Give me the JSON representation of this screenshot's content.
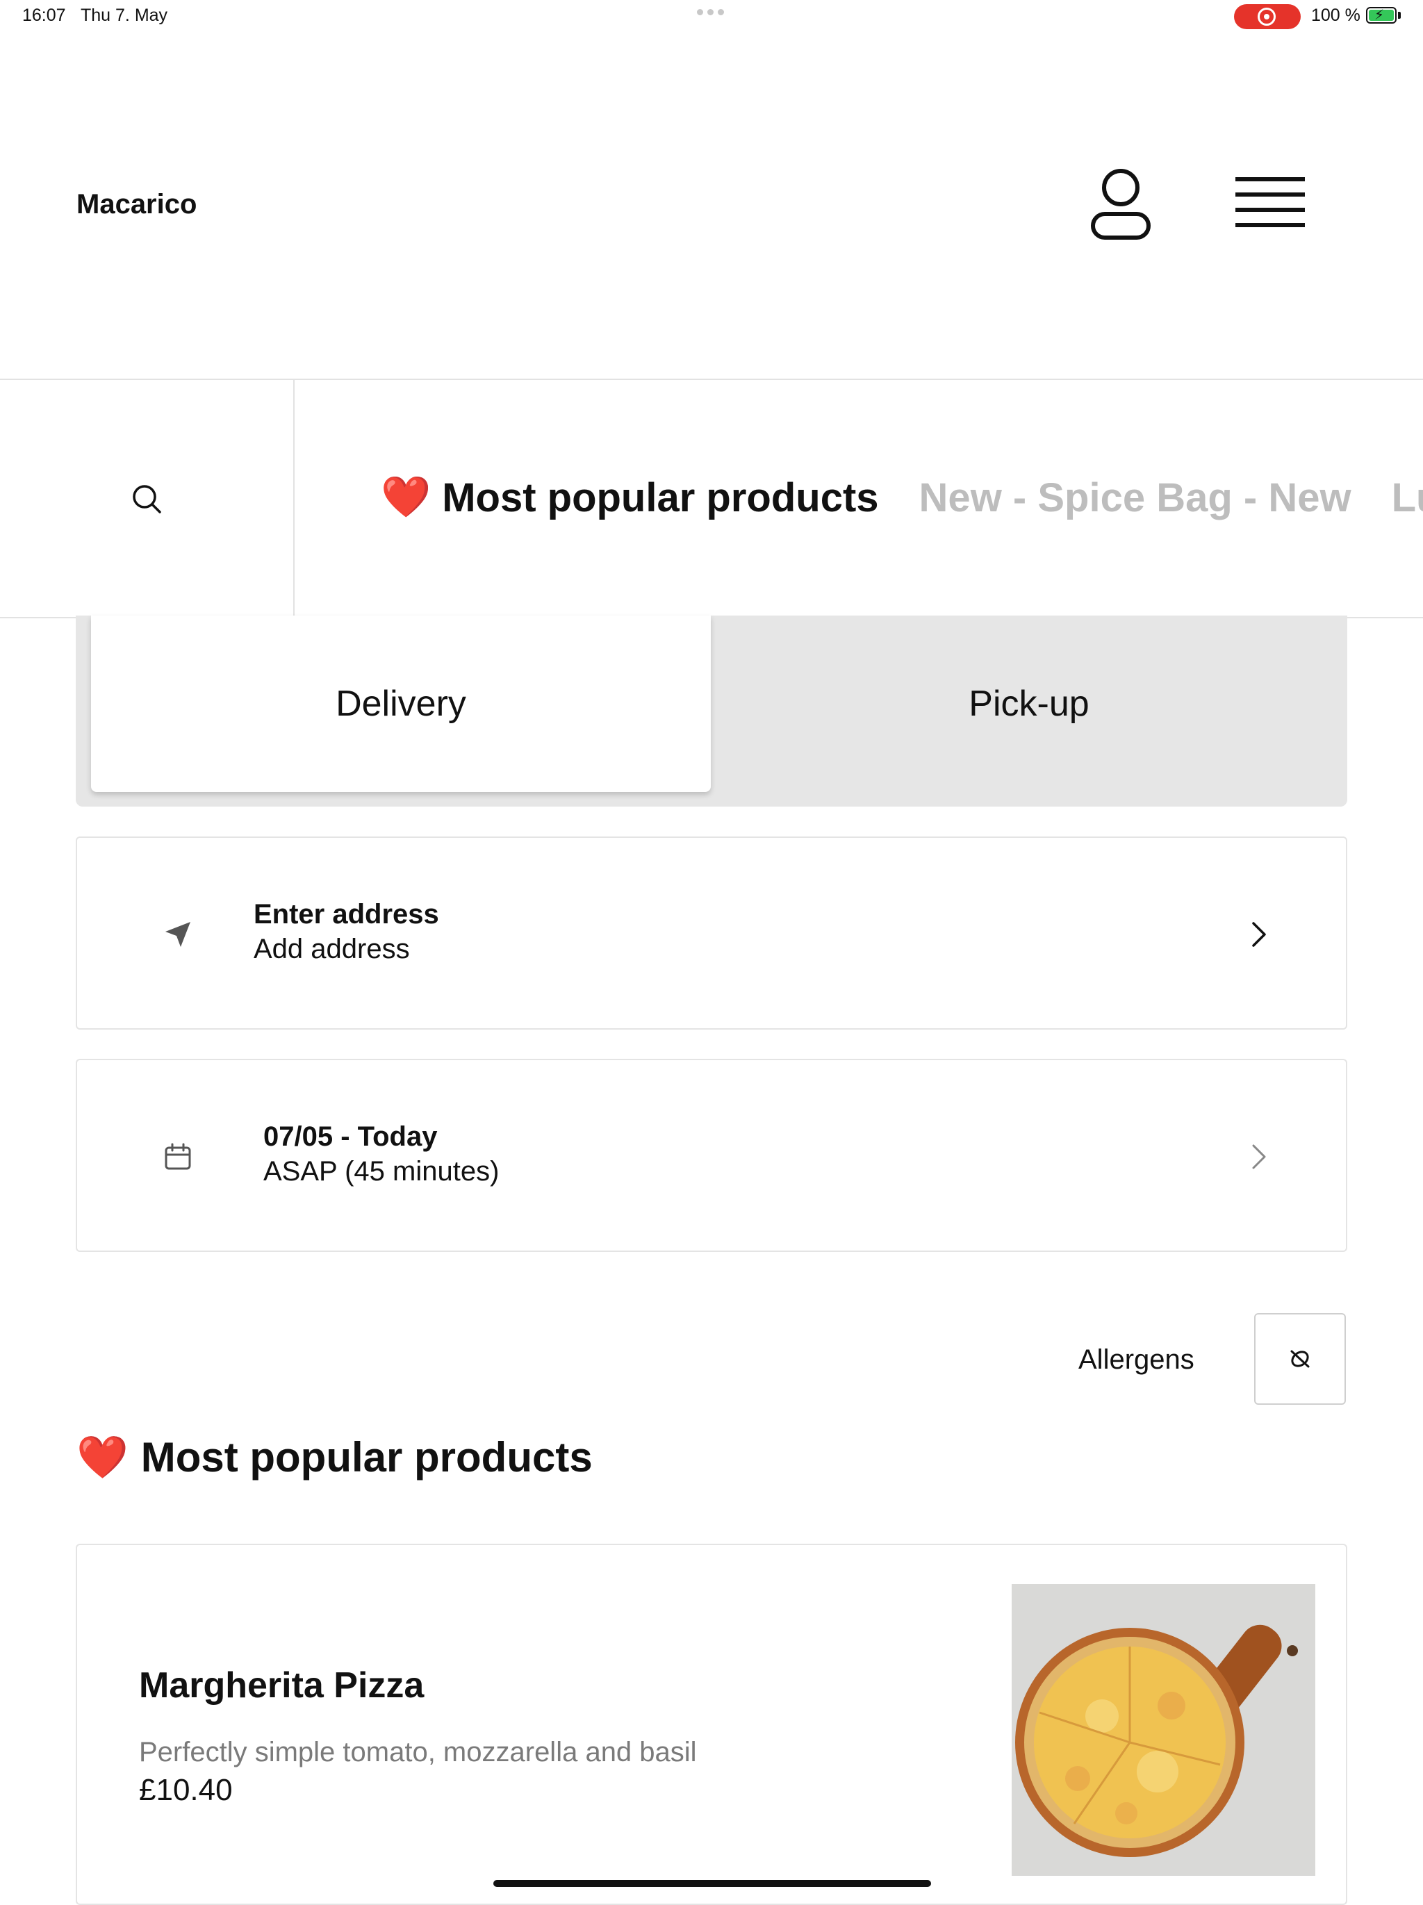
{
  "status_bar": {
    "time": "16:07",
    "date": "Thu 7. May",
    "battery_pct": "100 %",
    "recording_color": "#e5332a",
    "battery_color": "#34c759"
  },
  "header": {
    "brand": "Macarico",
    "user_icon": "user-icon",
    "menu_icon": "hamburger-menu-icon"
  },
  "categories": {
    "search_icon": "search-icon",
    "items": [
      {
        "emoji": "❤️",
        "label": "Most popular products",
        "active": true
      },
      {
        "emoji": "",
        "label": "New - Spice Bag - New",
        "active": false
      },
      {
        "emoji": "",
        "label": "Lu",
        "active": false
      }
    ]
  },
  "order_mode": {
    "options": [
      "Delivery",
      "Pick-up"
    ],
    "selected": "Delivery"
  },
  "address": {
    "icon": "location-arrow-icon",
    "title": "Enter address",
    "subtitle": "Add address"
  },
  "schedule": {
    "icon": "calendar-icon",
    "title": "07/05 - Today",
    "subtitle": "ASAP (45 minutes)"
  },
  "allergens": {
    "label": "Allergens",
    "icon": "allergen-filter-icon"
  },
  "section": {
    "emoji": "❤️",
    "title": "Most popular products"
  },
  "products": [
    {
      "name": "Margherita Pizza",
      "description": "Perfectly simple tomato, mozzarella and basil",
      "price": "£10.40",
      "image_icon": "pizza-image"
    }
  ]
}
